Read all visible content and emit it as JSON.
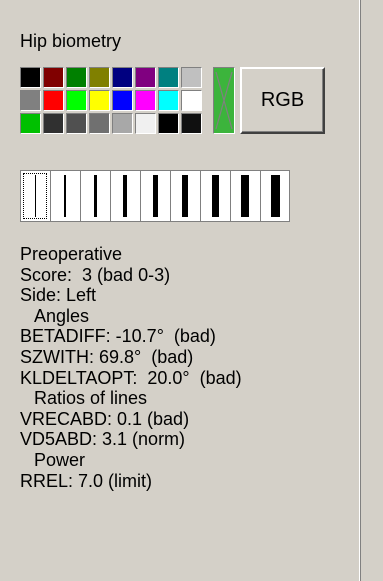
{
  "panel": {
    "title": "Hip biometry"
  },
  "palette": {
    "colors": [
      "#000000",
      "#800000",
      "#008000",
      "#808000",
      "#000080",
      "#800080",
      "#008080",
      "#c0c0c0",
      "#808080",
      "#ff0000",
      "#00ff00",
      "#ffff00",
      "#0000ff",
      "#ff00ff",
      "#00ffff",
      "#ffffff",
      "#00c000",
      "#303030",
      "#505050",
      "#707070",
      "#a8a8a8",
      "#f0f0f0",
      "#000000",
      "#101010"
    ],
    "current_color": "#3cb43c",
    "rgb_button_label": "RGB"
  },
  "line_widths": {
    "options": [
      1,
      2,
      3,
      4,
      5,
      6,
      7,
      8,
      9
    ],
    "selected_index": 0
  },
  "results": {
    "section_title": "Preoperative",
    "score": "Score:  3 (bad 0-3)",
    "side": "Side: Left",
    "angles_header": "Angles",
    "betadiff": "BETADIFF: -10.7°  (bad)",
    "szwith": "SZWITH: 69.8°  (bad)",
    "kldeltaopt": "KLDELTAOPT:  20.0°  (bad)",
    "ratios_header": "Ratios of lines",
    "vrecabd": "VRECABD: 0.1 (bad)",
    "vd5abd": "VD5ABD: 3.1 (norm)",
    "power_header": "Power",
    "rrel": "RREL: 7.0 (limit)"
  }
}
